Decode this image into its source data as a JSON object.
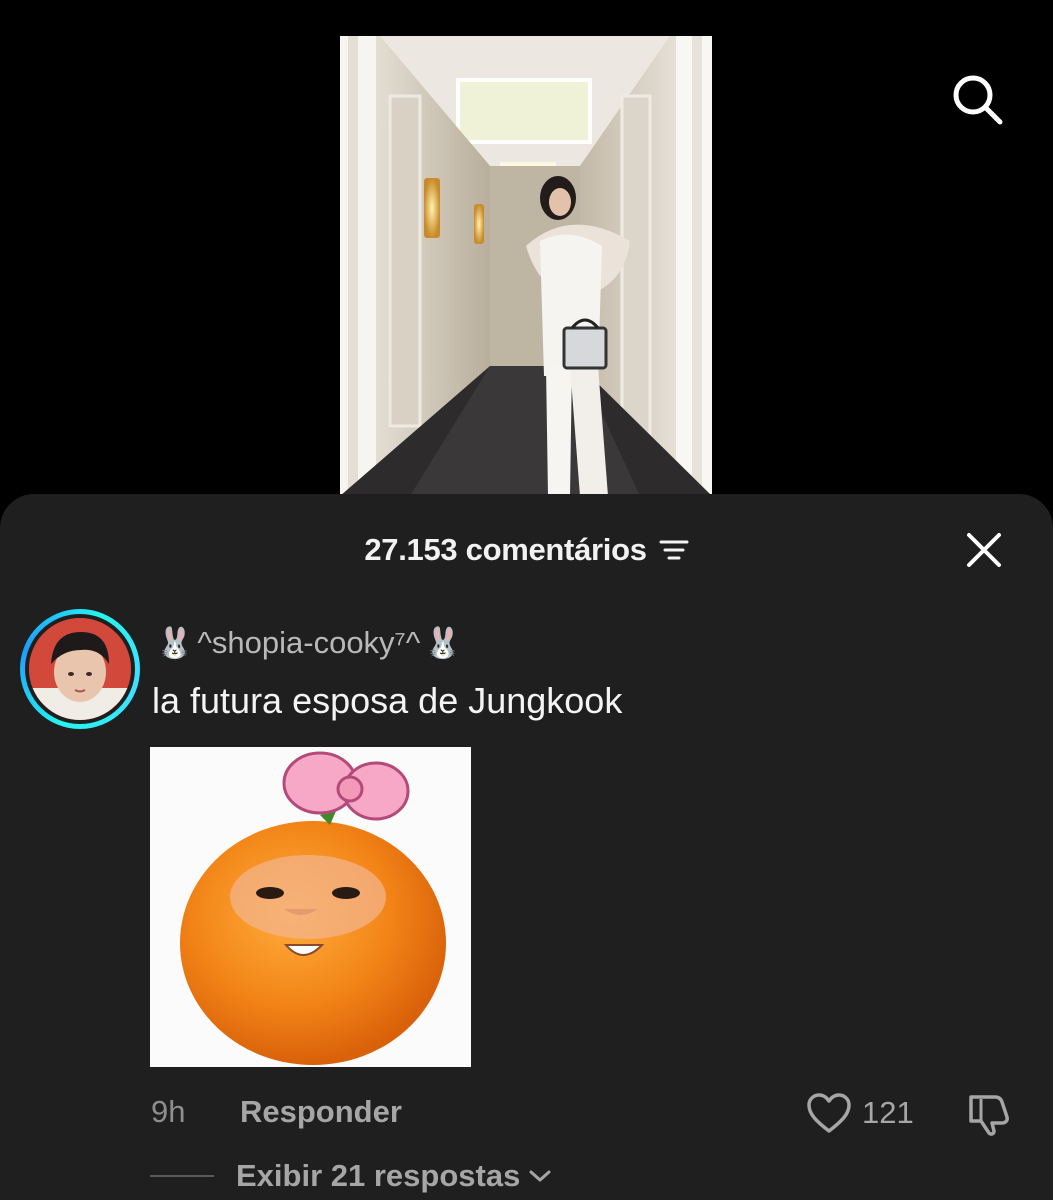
{
  "header": {
    "search_icon": "search-icon"
  },
  "comments_sheet": {
    "count_label": "27.153 comentários",
    "sort_icon": "filter-lines-icon",
    "close_icon": "close-icon",
    "comment": {
      "username_prefix_emoji": "🐰",
      "username": "^shopia-cooky⁷^",
      "username_suffix_emoji": "🐰",
      "text": "la futura esposa de Jungkook",
      "time": "9h",
      "reply_label": "Responder",
      "likes": "121",
      "like_icon": "heart-outline-icon",
      "dislike_icon": "thumbs-down-icon",
      "view_replies_label": "Exibir 21 respostas",
      "view_replies_icon": "chevron-down-icon"
    }
  },
  "colors": {
    "background": "#000000",
    "sheet": "#1f1f1f",
    "avatar_ring": "#25f4ee",
    "muted_text": "#a6a6a6"
  }
}
